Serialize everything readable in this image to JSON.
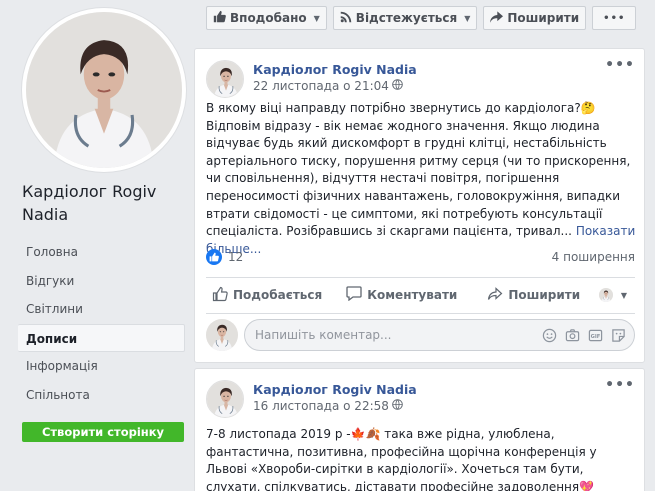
{
  "page": {
    "name": "Кардіолог Rogiv Nadia"
  },
  "nav": {
    "items": [
      {
        "label": "Головна"
      },
      {
        "label": "Відгуки"
      },
      {
        "label": "Світлини"
      },
      {
        "label": "Дописи"
      },
      {
        "label": "Інформація"
      },
      {
        "label": "Спільнота"
      }
    ],
    "active": "Дописи",
    "create_page_label": "Створити сторінку"
  },
  "action_bar": {
    "liked_label": "Вподобано",
    "following_label": "Відстежується",
    "share_label": "Поширити",
    "more_label": "•••"
  },
  "posts": [
    {
      "author": "Кардіолог Rogiv Nadia",
      "time": "22 листопада о 21:04",
      "text": "В якому віці направду потрібно звернутись до кардіолога?🤔 Відповім відразу - вік немає жодного значення. Якщо людина відчуває будь який дискомфорт в грудні клітці, нестабільність артеріального тиску, порушення ритму серця (чи то прискорення, чи сповільнення), відчуття нестачі повітря, погіршення переносимості фізичних навантажень, головокружіння, випадки втрати свідомості - це симптоми, які потребують консультації спеціаліста. Розібравшись зі скаргами пацієнта, тривал...",
      "see_more": "Показати більше...",
      "likes": "12",
      "shares": "4 поширення",
      "like_action": "Подобається",
      "comment_action": "Коментувати",
      "share_action": "Поширити",
      "comment_placeholder": "Напишіть коментар..."
    },
    {
      "author": "Кардіолог Rogiv Nadia",
      "time": "16 листопада о 22:58",
      "text": "7-8 листопада 2019 р -🍁🍂 така вже рідна, улюблена, фантастична, позитивна, професійна щорічна конференція у Львові «Хвороби-сирітки в кардіології». Хочеться там бути, слухати, спілкуватись, діставати професійне задоволення💖"
    }
  ],
  "icons": {
    "liked": "thumbs-up-icon",
    "following": "rss-icon",
    "share": "share-arrow-icon",
    "globe": "globe-icon",
    "emoji": "smiley-icon",
    "camera": "camera-icon",
    "gif": "gif-icon",
    "sticker": "sticker-icon"
  },
  "colors": {
    "link": "#385898",
    "reaction_blue": "#1877f2",
    "create_green": "#42b72a",
    "background": "#e9ebee"
  }
}
